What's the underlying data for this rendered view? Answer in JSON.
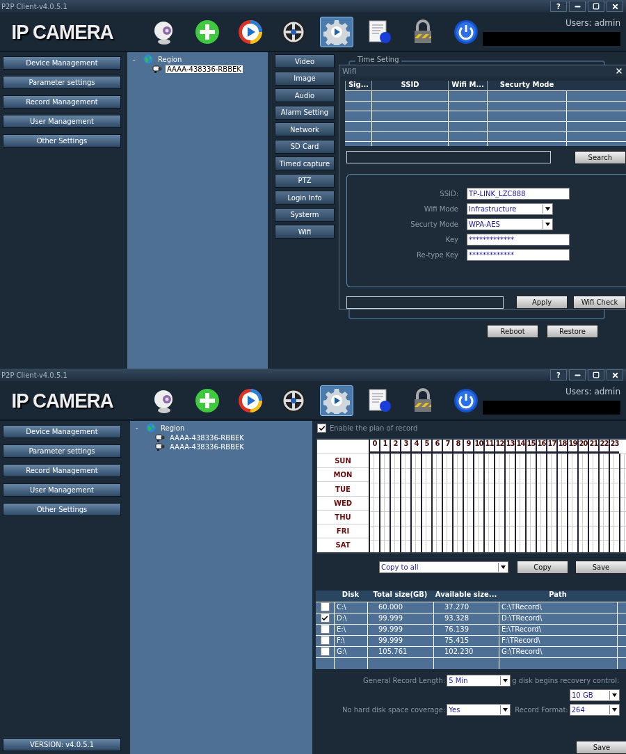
{
  "windows": [
    {
      "kind": "parameters",
      "title": "P2P Client-v4.0.5.1",
      "help": "?",
      "logo": "IP CAMERA",
      "users": "Users: admin",
      "toolbar": [
        {
          "kind": "webcam",
          "selected": false
        },
        {
          "kind": "add",
          "selected": false
        },
        {
          "kind": "play",
          "selected": false
        },
        {
          "kind": "reel",
          "selected": false
        },
        {
          "kind": "gear",
          "selected": true
        },
        {
          "kind": "document",
          "selected": false
        },
        {
          "kind": "lock",
          "selected": false
        },
        {
          "kind": "power",
          "selected": false
        }
      ],
      "nav": [
        "Device Management",
        "Parameter settings",
        "Record Management",
        "User Management",
        "Other Settings"
      ],
      "tree": {
        "toggle": "-",
        "label": "Region",
        "children": [
          {
            "label": "AAAA-438336-RBBEK",
            "selected": true
          }
        ]
      },
      "submenu": [
        "Video",
        "Image",
        "Audio",
        "Alarm Setting",
        "Network",
        "SD Card",
        "Timed capture",
        "PTZ",
        "Login Info",
        "Systerm",
        "Wifi"
      ],
      "group_title": "Time Seting",
      "dialog": {
        "title": "Wifi",
        "columns": [
          "Sig...",
          "SSID",
          "Wifi M...",
          "Securty Mode"
        ],
        "search": "Search",
        "fields": [
          {
            "kind": "text",
            "label": "SSID:",
            "value": "TP-LINK_LZC888"
          },
          {
            "kind": "select",
            "label": "Wifi Mode",
            "value": "Infrastructure"
          },
          {
            "kind": "select",
            "label": "Securty Mode",
            "value": "WPA-AES"
          },
          {
            "kind": "text",
            "label": "Key",
            "value": "*************"
          },
          {
            "kind": "text",
            "label": "Re-type Key",
            "value": "*************"
          }
        ],
        "buttons": [
          "Apply",
          "Wifi Check"
        ]
      },
      "buttons": [
        "Reboot",
        "Restore"
      ]
    },
    {
      "kind": "record",
      "title": "P2P Client-v4.0.5.1",
      "help": "?",
      "logo": "IP CAMERA",
      "users": "Users: admin",
      "toolbar": [
        {
          "kind": "webcam",
          "selected": false
        },
        {
          "kind": "add",
          "selected": false
        },
        {
          "kind": "play",
          "selected": false
        },
        {
          "kind": "reel",
          "selected": false
        },
        {
          "kind": "gear",
          "selected": true
        },
        {
          "kind": "document",
          "selected": false
        },
        {
          "kind": "lock",
          "selected": false
        },
        {
          "kind": "power",
          "selected": false
        }
      ],
      "nav": [
        "Device Management",
        "Parameter settings",
        "Record Management",
        "User Management",
        "Other Settings"
      ],
      "version": "VERSION: v4.0.5.1",
      "tree": {
        "toggle": "-",
        "label": "Region",
        "children": [
          {
            "label": "AAAA-438336-RBBEK",
            "selected": false
          },
          {
            "label": "AAAA-438336-RBBEK",
            "selected": false
          }
        ]
      },
      "enable": {
        "label": "Enable the plan of record",
        "checked": true
      },
      "days": [
        "SUN",
        "MON",
        "TUE",
        "WED",
        "THU",
        "FRI",
        "SAT"
      ],
      "hours": [
        "0",
        "1",
        "2",
        "3",
        "4",
        "5",
        "6",
        "7",
        "8",
        "9",
        "10",
        "11",
        "12",
        "13",
        "14",
        "15",
        "16",
        "17",
        "18",
        "19",
        "20",
        "21",
        "22",
        "23"
      ],
      "copy_select": "Copy to all",
      "copy_buttons": [
        "Copy",
        "Save"
      ],
      "disk_columns": [
        "Disk",
        "Total size(GB)",
        "Available size...",
        "Path"
      ],
      "disks": [
        {
          "checked": false,
          "cells": [
            "C:\\",
            "60.000",
            "37.270",
            "C:\\TRecord\\"
          ]
        },
        {
          "checked": true,
          "cells": [
            "D:\\",
            "99.999",
            "93.328",
            "D:\\TRecord\\"
          ]
        },
        {
          "checked": false,
          "cells": [
            "E:\\",
            "99.999",
            "76.139",
            "E:\\TRecord\\"
          ]
        },
        {
          "checked": false,
          "cells": [
            "F:\\",
            "99.999",
            "75.415",
            "F:\\TRecord\\"
          ]
        },
        {
          "checked": false,
          "cells": [
            "G:\\",
            "105.761",
            "102.230",
            "G:\\TRecord\\"
          ]
        }
      ],
      "settings": [
        {
          "label": "General Record Length:",
          "value": "5 Min"
        },
        {
          "label": "g disk begins recovery control:",
          "value": "10 GB"
        },
        {
          "label": "No hard disk space coverage:",
          "value": "Yes"
        },
        {
          "label": "Record Format:",
          "value": "264"
        }
      ],
      "save": "Save"
    }
  ]
}
